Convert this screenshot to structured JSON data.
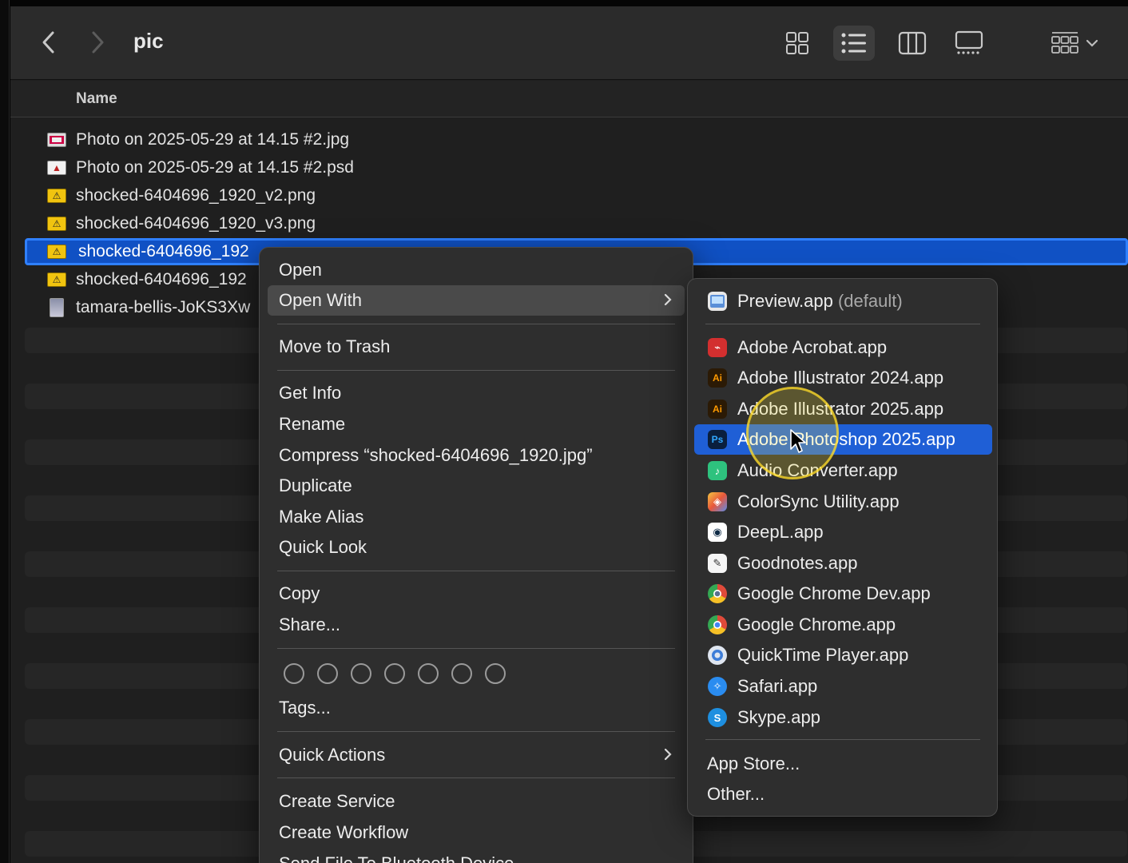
{
  "window": {
    "title": "pic",
    "column_header": "Name"
  },
  "toolbar": {
    "back_icon": "chevron-left-icon",
    "forward_icon": "chevron-right-icon",
    "views": [
      "icon-view",
      "list-view",
      "column-view",
      "gallery-view",
      "group-by"
    ],
    "active_view": "list-view"
  },
  "files": [
    {
      "name": "Photo on 2025-05-29 at 14.15 #2.jpg",
      "icon": "jpg-image-icon"
    },
    {
      "name": "Photo on 2025-05-29 at 14.15 #2.psd",
      "icon": "psd-file-icon"
    },
    {
      "name": "shocked-6404696_1920_v2.png",
      "icon": "png-file-icon"
    },
    {
      "name": "shocked-6404696_1920_v3.png",
      "icon": "png-file-icon"
    },
    {
      "name": "shocked-6404696_192",
      "icon": "png-file-icon",
      "selected": true
    },
    {
      "name": "shocked-6404696_192",
      "icon": "png-file-icon"
    },
    {
      "name": "tamara-bellis-JoKS3Xw",
      "icon": "portrait-image-icon"
    }
  ],
  "context_menu": {
    "open": "Open",
    "open_with": "Open With",
    "move_to_trash": "Move to Trash",
    "get_info": "Get Info",
    "rename": "Rename",
    "compress": "Compress “shocked-6404696_1920.jpg”",
    "duplicate": "Duplicate",
    "make_alias": "Make Alias",
    "quick_look": "Quick Look",
    "copy": "Copy",
    "share": "Share...",
    "tags": "Tags...",
    "quick_actions": "Quick Actions",
    "create_service": "Create Service",
    "create_workflow": "Create Workflow",
    "send_bluetooth": "Send File To Bluetooth Device"
  },
  "open_with": {
    "default_app": "Preview.app",
    "default_suffix": "(default)",
    "apps": [
      {
        "label": "Adobe Acrobat.app",
        "icon": "acrobat-icon",
        "color": "#d32f2f",
        "glyph": "⌁"
      },
      {
        "label": "Adobe Illustrator 2024.app",
        "icon": "illustrator-icon",
        "color": "#2b1a05",
        "glyph": "Ai"
      },
      {
        "label": "Adobe Illustrator 2025.app",
        "icon": "illustrator-icon",
        "color": "#2b1a05",
        "glyph": "Ai"
      },
      {
        "label": "Adobe Photoshop 2025.app",
        "icon": "photoshop-icon",
        "color": "#0a1f3d",
        "glyph": "Ps"
      },
      {
        "label": "Audio Converter.app",
        "icon": "audio-converter-icon",
        "color": "#2ec27e",
        "glyph": "♪"
      },
      {
        "label": "ColorSync Utility.app",
        "icon": "colorsync-icon",
        "color": "#e8a33b",
        "glyph": "◈"
      },
      {
        "label": "DeepL.app",
        "icon": "deepl-icon",
        "color": "#ffffff",
        "glyph": "◉"
      },
      {
        "label": "Goodnotes.app",
        "icon": "goodnotes-icon",
        "color": "#f5f5f5",
        "glyph": "✎"
      },
      {
        "label": "Google Chrome Dev.app",
        "icon": "chrome-dev-icon",
        "color": "#f0a01a",
        "glyph": "◎"
      },
      {
        "label": "Google Chrome.app",
        "icon": "chrome-icon",
        "color": "#e04a3a",
        "glyph": "◎"
      },
      {
        "label": "QuickTime Player.app",
        "icon": "quicktime-icon",
        "color": "#3d7dd8",
        "glyph": "Q"
      },
      {
        "label": "Safari.app",
        "icon": "safari-icon",
        "color": "#2a8cf0",
        "glyph": "✧"
      },
      {
        "label": "Skype.app",
        "icon": "skype-icon",
        "color": "#1e8fe0",
        "glyph": "S"
      }
    ],
    "highlighted": "Adobe Photoshop 2025.app",
    "app_store": "App Store...",
    "other": "Other..."
  },
  "colors": {
    "selection": "#1051c4",
    "menu_highlight": "#1f5fd6"
  }
}
